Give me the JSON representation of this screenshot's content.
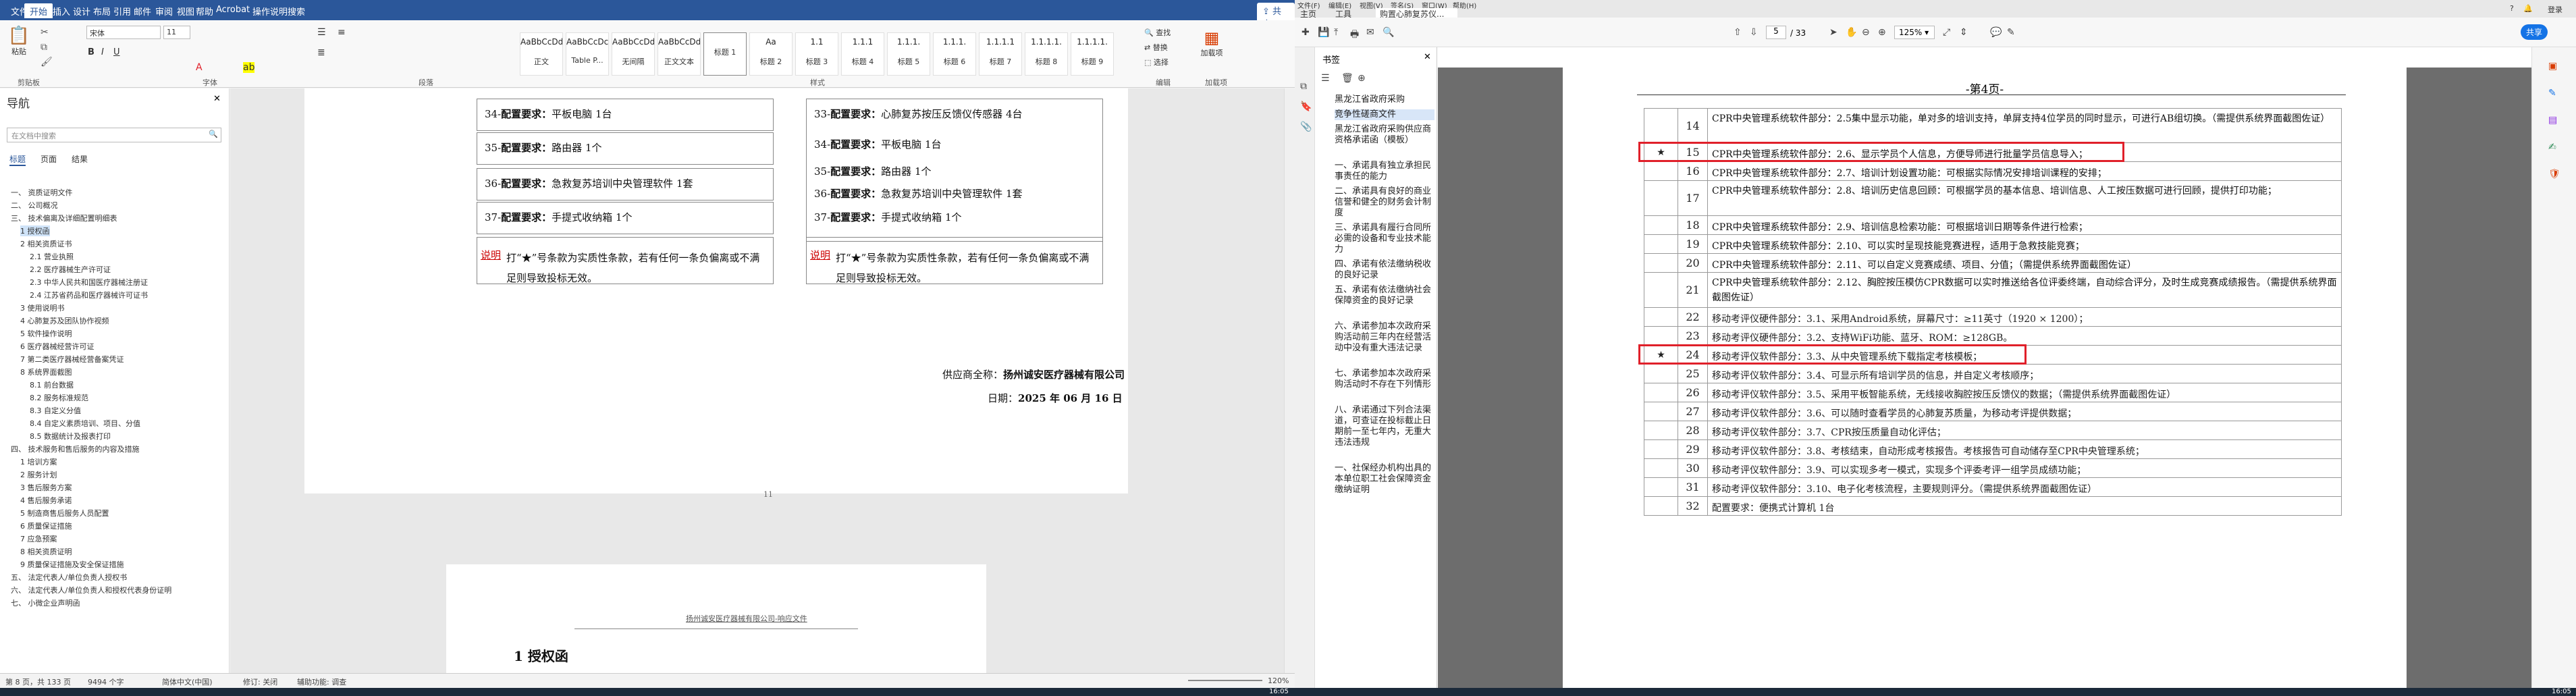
{
  "word": {
    "tabs": [
      "文件",
      "开始",
      "插入",
      "设计",
      "布局",
      "引用",
      "邮件",
      "审阅",
      "视图",
      "帮助",
      "Acrobat",
      "操作说明搜索"
    ],
    "share": "共享",
    "font_name": "宋体",
    "font_size": "11",
    "styles": [
      {
        "sample": "AaBbCcDd",
        "name": "正文"
      },
      {
        "sample": "AaBbCcDc",
        "name": "Table P..."
      },
      {
        "sample": "AaBbCcDd",
        "name": "无间隔"
      },
      {
        "sample": "AaBbCcDd",
        "name": "正文文本"
      },
      {
        "sample": "",
        "name": "标题 1"
      },
      {
        "sample": "Aa",
        "name": "标题 2"
      },
      {
        "sample": "1.1",
        "name": "标题 3"
      },
      {
        "sample": "1.1.1",
        "name": "标题 4"
      },
      {
        "sample": "1.1.1.",
        "name": "标题 5"
      },
      {
        "sample": "1.1.1.",
        "name": "标题 6"
      },
      {
        "sample": "1.1.1.1",
        "name": "标题 7"
      },
      {
        "sample": "1.1.1.1.",
        "name": "标题 8"
      },
      {
        "sample": "1.1.1.1.",
        "name": "标题 9"
      }
    ],
    "groups": [
      "剪贴板",
      "字体",
      "段落",
      "样式",
      "编辑",
      "加载项"
    ],
    "edit_items": [
      "查找",
      "替换",
      "选择"
    ],
    "addin": "加载项",
    "paste": "粘贴",
    "nav": {
      "title": "导航",
      "search_placeholder": "在文档中搜索",
      "tabs": [
        "标题",
        "页面",
        "结果"
      ],
      "items": [
        "一、 资质证明文件",
        "二、 公司概况",
        "三、 技术偏离及详细配置明细表",
        "1 授权函",
        "2 相关资质证书",
        "2.1 营业执照",
        "2.2 医疗器械生产许可证",
        "2.3 中华人民共和国医疗器械注册证",
        "2.4 江苏省药品和医疗器械许可证书",
        "3 使用说明书",
        "4 心肺复苏及团队协作视频",
        "5 软件操作说明",
        "6 医疗器械经营许可证",
        "7 第二类医疗器械经营备案凭证",
        "8 系统界面截图",
        "8.1 前台数据",
        "8.2 服务标准规范",
        "8.3 自定义分值",
        "8.4 自定义素质培训、项目、分值",
        "8.5 数据统计及报表打印",
        "四、 技术服务和售后服务的内容及措施",
        "1 培训方案",
        "2 服务计划",
        "3 售后服务方案",
        "4 售后服务承诺",
        "5 制造商售后服务人员配置",
        "6 质量保证措施",
        "7 应急预案",
        "8 相关资质证明",
        "9 质量保证措施及安全保证措施",
        "五、 法定代表人/单位负责人授权书",
        "六、 法定代表人/单位负责人和授权代表身份证明",
        "七、 小微企业声明函"
      ]
    },
    "doc": {
      "rows_left": [
        [
          "34-",
          "配置要求：",
          "平板电脑",
          "1台"
        ],
        [
          "35-",
          "配置要求：",
          "路由器",
          "1个"
        ],
        [
          "36-",
          "配置要求：",
          "急救复苏培训中央管理软件",
          "1套"
        ],
        [
          "37-",
          "配置要求：",
          "手提式收纳箱",
          "1个"
        ]
      ],
      "rows_right": [
        [
          "33-",
          "配置要求：",
          "心肺复苏按压反馈仪传感器",
          "4台"
        ],
        [
          "34-",
          "配置要求：",
          "平板电脑",
          "1台"
        ],
        [
          "35-",
          "配置要求：",
          "路由器",
          "1个"
        ],
        [
          "36-",
          "配置要求：",
          "急救复苏培训中央管理软件",
          "1套"
        ],
        [
          "37-",
          "配置要求：",
          "手提式收纳箱",
          "1个"
        ]
      ],
      "note_label": "说明",
      "note": "打“★”号条款为实质性条款，若有任何一条负偏离或不满足则导致投标无效。",
      "supplier_label": "供应商全称：",
      "supplier": "扬州诚安医疗器械有限公司",
      "date_label": "日期：",
      "date": "2025 年 06 月 16 日",
      "page_num": "11",
      "header2": "扬州诚安医疗器械有限公司-响应文件",
      "heading2": "1    授权函"
    },
    "status": {
      "page": "第 8 页，共 133 页",
      "words": "9494 个字",
      "lang": "简体中文(中国)",
      "track": "修订: 关闭",
      "access": "辅助功能: 调查",
      "zoom": "120%"
    }
  },
  "pdf": {
    "tabs": [
      "主页",
      "工具",
      "购置心肺复苏仪..."
    ],
    "menu": [
      "文件(F)",
      "编辑(E)",
      "视图(V)",
      "签名(S)",
      "窗口(W)",
      "帮助(H)"
    ],
    "login": "登录",
    "share": "共享",
    "page_cur": "5",
    "page_total": "/ 33",
    "zoom": "125%",
    "bookmarks_title": "书签",
    "bookmarks": [
      "黑龙江省政府采购",
      "竞争性磋商文件",
      "黑龙江省政府采购供应商资格承诺函（模板）",
      "一、承诺具有独立承担民事责任的能力",
      "二、承诺具有良好的商业信誉和健全的财务会计制度",
      "三、承诺具有履行合同所必需的设备和专业技术能力",
      "四、承诺有依法缴纳税收的良好记录",
      "五、承诺有依法缴纳社会保障资金的良好记录",
      "六、承诺参加本次政府采购活动前三年内在经营活动中没有重大违法记录",
      "七、承诺参加本次政府采购活动时不存在下列情形",
      "八、承诺通过下列合法渠道，可查证在投标截止日期前一至七年内，无重大违法违规",
      "一、社保经办机构出具的本单位职工社会保障资金缴纳证明"
    ],
    "page_title": "-第4页-",
    "rows": [
      {
        "star": "",
        "num": "14",
        "text": "CPR中央管理系统软件部分：2.5集中显示功能，单对多的培训支持，单屏支持4位学员的同时显示，可进行AB组切换。（需提供系统界面截图佐证）"
      },
      {
        "star": "★",
        "num": "15",
        "text": "CPR中央管理系统软件部分：2.6、显示学员个人信息，方便导师进行批量学员信息导入；"
      },
      {
        "star": "",
        "num": "16",
        "text": "CPR中央管理系统软件部分：2.7、培训计划设置功能：可根据实际情况安排培训课程的安排；"
      },
      {
        "star": "",
        "num": "17",
        "text": "CPR中央管理系统软件部分：2.8、培训历史信息回顾：可根据学员的基本信息、培训信息、人工按压数据可进行回顾，提供打印功能；"
      },
      {
        "star": "",
        "num": "18",
        "text": "CPR中央管理系统软件部分：2.9、培训信息检索功能：可根据培训日期等条件进行检索；"
      },
      {
        "star": "",
        "num": "19",
        "text": "CPR中央管理系统软件部分：2.10、可以实时呈现技能竞赛进程，适用于急救技能竞赛；"
      },
      {
        "star": "",
        "num": "20",
        "text": "CPR中央管理系统软件部分：2.11、可以自定义竞赛成绩、项目、分值；（需提供系统界面截图佐证）"
      },
      {
        "star": "",
        "num": "21",
        "text": "CPR中央管理系统软件部分：2.12、胸腔按压模仿CPR数据可以实时推送给各位评委终端，自动综合评分，及时生成竞赛成绩报告。（需提供系统界面截图佐证）"
      },
      {
        "star": "",
        "num": "22",
        "text": "移动考评仪硬件部分：3.1、采用Android系统，屏幕尺寸：≥11英寸（1920 × 1200）；"
      },
      {
        "star": "",
        "num": "23",
        "text": "移动考评仪硬件部分：3.2、支持WiFi功能、蓝牙、ROM：≥128GB。"
      },
      {
        "star": "★",
        "num": "24",
        "text": "移动考评仪软件部分：3.3、从中央管理系统下载指定考核模板；"
      },
      {
        "star": "",
        "num": "25",
        "text": "移动考评仪软件部分：3.4、可显示所有培训学员的信息，并自定义考核顺序；"
      },
      {
        "star": "",
        "num": "26",
        "text": "移动考评仪软件部分：3.5、采用平板智能系统，无线接收胸腔按压反馈仪的数据；（需提供系统界面截图佐证）"
      },
      {
        "star": "",
        "num": "27",
        "text": "移动考评仪软件部分：3.6、可以随时查看学员的心肺复苏质量，为移动考评提供数据；"
      },
      {
        "star": "",
        "num": "28",
        "text": "移动考评仪软件部分：3.7、CPR按压质量自动化评估；"
      },
      {
        "star": "",
        "num": "29",
        "text": "移动考评仪软件部分：3.8、考核结束，自动形成考核报告。考核报告可自动储存至CPR中央管理系统；"
      },
      {
        "star": "",
        "num": "30",
        "text": "移动考评仪软件部分：3.9、可以实现多考一模式，实现多个评委考评一组学员成绩功能；"
      },
      {
        "star": "",
        "num": "31",
        "text": "移动考评仪软件部分：3.10、电子化考核流程，主要规则评分。（需提供系统界面截图佐证）"
      },
      {
        "star": "",
        "num": "32",
        "text": "配置要求：便携式计算机 1台"
      }
    ]
  },
  "taskbar": {
    "time1": "16:05",
    "time2": "16:05"
  }
}
